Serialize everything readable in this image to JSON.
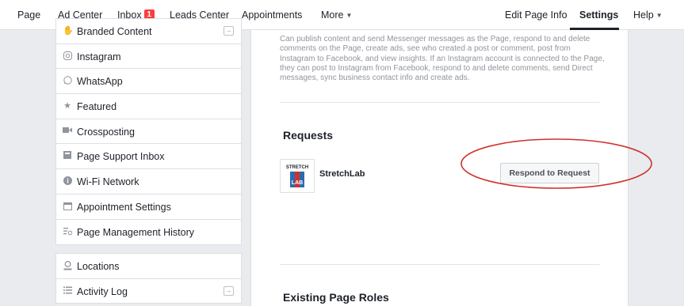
{
  "nav": {
    "page": "Page",
    "ad_center": "Ad Center",
    "inbox": "Inbox",
    "inbox_badge": "1",
    "leads_center": "Leads Center",
    "appointments": "Appointments",
    "more": "More",
    "edit_page_info": "Edit Page Info",
    "settings": "Settings",
    "help": "Help"
  },
  "sidebar": {
    "group1": [
      {
        "label": "Branded Content",
        "icon": "handshake-icon"
      },
      {
        "label": "Instagram",
        "icon": "instagram-icon"
      },
      {
        "label": "WhatsApp",
        "icon": "whatsapp-icon"
      },
      {
        "label": "Featured",
        "icon": "star-icon"
      },
      {
        "label": "Crossposting",
        "icon": "video-camera-icon"
      },
      {
        "label": "Page Support Inbox",
        "icon": "support-icon"
      },
      {
        "label": "Wi-Fi Network",
        "icon": "info-icon"
      },
      {
        "label": "Appointment Settings",
        "icon": "calendar-icon"
      },
      {
        "label": "Page Management History",
        "icon": "history-icon"
      }
    ],
    "group2": [
      {
        "label": "Locations",
        "icon": "location-icon"
      },
      {
        "label": "Activity Log",
        "icon": "list-icon"
      }
    ]
  },
  "main": {
    "role_description": "Can publish content and send Messenger messages as the Page, respond to and delete comments on the Page, create ads, see who created a post or comment, post from Instagram to Facebook, and view insights. If an Instagram account is connected to the Page, they can post to Instagram from Facebook, respond to and delete comments, send Direct messages, sync business contact info and create ads.",
    "requests_title": "Requests",
    "request": {
      "name": "StretchLab",
      "logo_text_top": "STRETCH",
      "logo_text_bottom": "LAB",
      "button_label": "Respond to Request"
    },
    "existing_roles_title": "Existing Page Roles"
  },
  "colors": {
    "annotation_ellipse": "#d0312d",
    "badge": "#fa3e3e",
    "logo_blue": "#2b6cb0",
    "logo_red": "#d0312d"
  }
}
